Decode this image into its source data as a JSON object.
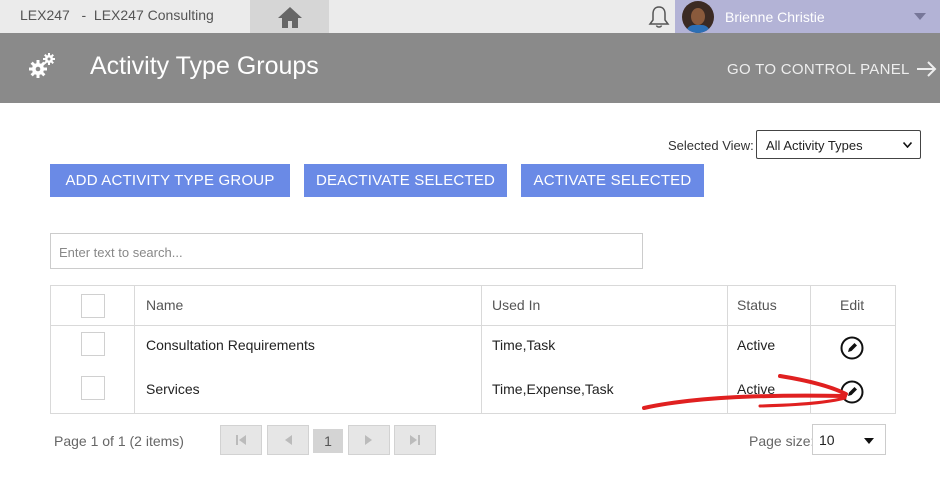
{
  "topbar": {
    "app_title": "LEX247   -  LEX247 Consulting",
    "home_icon": "home-icon",
    "bell_icon": "bell-icon",
    "user_name": "Brienne Christie"
  },
  "header": {
    "title": "Activity Type Groups",
    "control_panel_link": "GO TO CONTROL PANEL"
  },
  "view": {
    "label": "Selected View:",
    "selected": "All Activity Types"
  },
  "toolbar": {
    "add_label": "ADD ACTIVITY TYPE GROUP",
    "deactivate_label": "DEACTIVATE SELECTED",
    "activate_label": "ACTIVATE SELECTED"
  },
  "search": {
    "placeholder": "Enter text to search..."
  },
  "table": {
    "columns": [
      "Name",
      "Used In",
      "Status",
      "Edit"
    ],
    "rows": [
      {
        "name": "Consultation Requirements",
        "used_in": "Time,Task",
        "status": "Active"
      },
      {
        "name": "Services",
        "used_in": "Time,Expense,Task",
        "status": "Active"
      }
    ]
  },
  "pager": {
    "info": "Page 1 of 1 (2 items)",
    "current_page": "1",
    "page_size_label": "Page size:",
    "page_size": "10"
  },
  "colors": {
    "accent_button": "#6a8ae6",
    "header_bg": "#8a8a8a",
    "annotation": "#e02020"
  }
}
